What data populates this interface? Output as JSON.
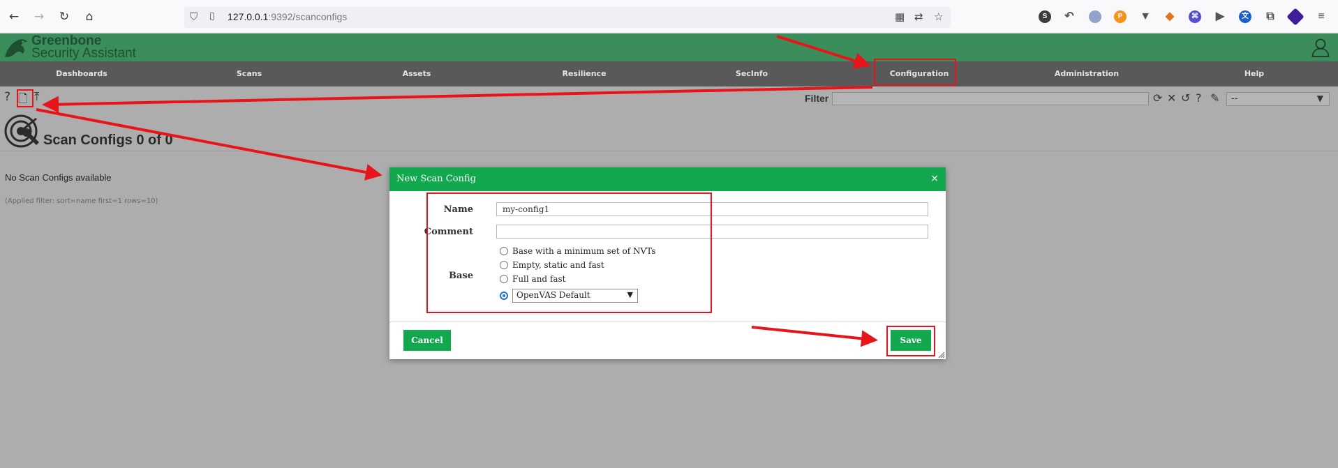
{
  "browser": {
    "url_host": "127.0.0.1",
    "url_rest": ":9392/scanconfigs"
  },
  "app": {
    "brand_line1": "Greenbone",
    "brand_line2": "Security Assistant"
  },
  "menu": {
    "items": [
      "Dashboards",
      "Scans",
      "Assets",
      "Resilience",
      "SecInfo",
      "Configuration",
      "Administration",
      "Help"
    ]
  },
  "toolbar": {
    "filter_label": "Filter",
    "filter_value": "",
    "filter_select_value": "--"
  },
  "page": {
    "title": "Scan Configs 0 of 0",
    "empty_message": "No Scan Configs available",
    "applied_filter": "(Applied filter: sort=name first=1 rows=10)"
  },
  "dialog": {
    "title": "New Scan Config",
    "close": "×",
    "name_label": "Name",
    "name_value": "my-config1",
    "comment_label": "Comment",
    "comment_value": "",
    "base_label": "Base",
    "base_options": [
      "Base with a minimum set of NVTs",
      "Empty, static and fast",
      "Full and fast"
    ],
    "base_selected_value": "OpenVAS Default",
    "cancel_label": "Cancel",
    "save_label": "Save"
  },
  "annotation_color": "#e8141a"
}
